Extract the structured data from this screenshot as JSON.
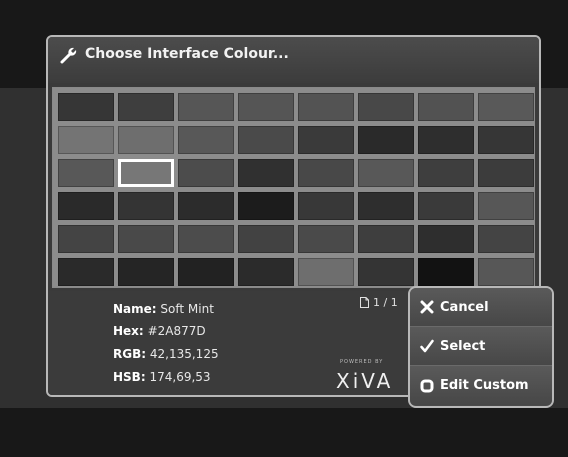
{
  "dialog": {
    "title": "Choose Interface Colour...",
    "icon": "wrench-icon"
  },
  "swatch_rows": [
    [
      "#363636",
      "#3e3e3e",
      "#565656",
      "#555555",
      "#535353",
      "#484848",
      "#525252",
      "#595959"
    ],
    [
      "#747474",
      "#6e6e6e",
      "#585858",
      "#4a4a4a",
      "#3a3a3a",
      "#2a2a2a",
      "#2e2e2e",
      "#363636"
    ],
    [
      "#585858",
      "#777777",
      "#4c4c4c",
      "#303030",
      "#484848",
      "#585858",
      "#3e3e3e",
      "#3c3c3c"
    ],
    [
      "#2a2a2a",
      "#343434",
      "#2c2c2c",
      "#1c1c1c",
      "#383838",
      "#2e2e2e",
      "#3a3a3a",
      "#575757"
    ],
    [
      "#444444",
      "#494949",
      "#4c4c4c",
      "#424242",
      "#4a4a4a",
      "#3e3e3e",
      "#2e2e2e",
      "#444444"
    ],
    [
      "#2a2a2a",
      "#252525",
      "#222222",
      "#2b2b2b",
      "#6e6e6e",
      "#343434",
      "#121212",
      "#575757"
    ]
  ],
  "selected_swatch": {
    "row": 2,
    "col": 1
  },
  "info": {
    "name_label": "Name:",
    "name_value": "Soft Mint",
    "hex_label": "Hex:",
    "hex_value": "#2A877D",
    "rgb_label": "RGB:",
    "rgb_value": "42,135,125",
    "hsb_label": "HSB:",
    "hsb_value": "174,69,53",
    "page_indicator": "1 / 1",
    "powered_by": "POWERED BY",
    "logo_text": "XiVA"
  },
  "menu": {
    "cancel_label": "Cancel",
    "select_label": "Select",
    "edit_custom_label": "Edit Custom"
  }
}
